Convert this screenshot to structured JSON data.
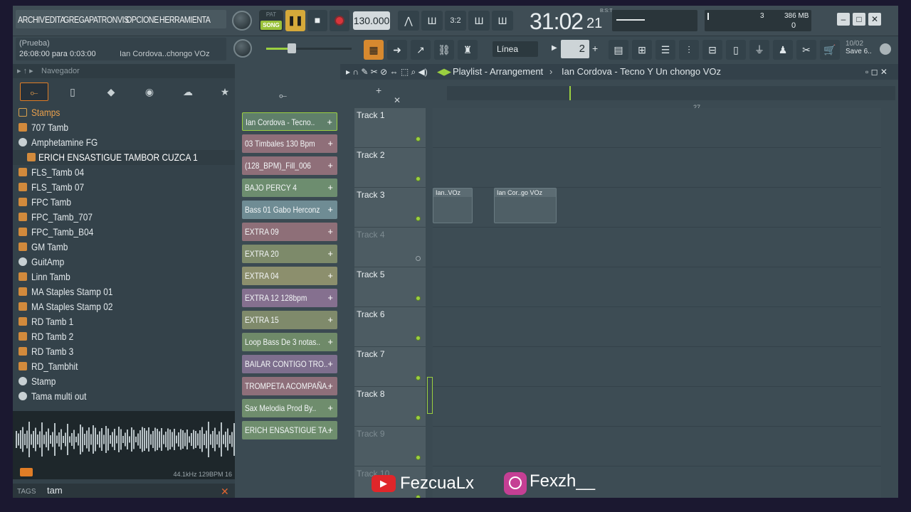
{
  "menu": {
    "items": [
      "ARCHIV",
      "EDITA",
      "GREGA",
      "PATRON",
      "VIS",
      "OPCIONE",
      "HERRAMIENTA"
    ]
  },
  "hint": {
    "line1": "(Prueba)",
    "line2": "26:08:00 para 0:03:00",
    "line3": "Ian Cordova..chongo VOz"
  },
  "transport": {
    "pat_label": "PAT",
    "song_label": "SONG",
    "play_icon": "pause-icon",
    "tempo": "130.000",
    "time_main": "31:02",
    "time_sub": "21",
    "time_bst": "B:S:T"
  },
  "monitor": {
    "cpu_value": "3",
    "mem_value": "386 MB",
    "poly_value": "0"
  },
  "toolbar2": {
    "snap": "Línea",
    "step": "2",
    "save_top": "10/02",
    "save_bottom": "Save 6.."
  },
  "browser": {
    "title": "Navegador",
    "items": [
      {
        "label": "Stamps",
        "type": "folder"
      },
      {
        "label": "707 Tamb",
        "type": "file"
      },
      {
        "label": "Amphetamine FG",
        "type": "plugin"
      },
      {
        "label": "ERICH ENSASTIGUE TAMBOR CUZCA 1",
        "type": "file"
      },
      {
        "label": "FLS_Tamb 04",
        "type": "file"
      },
      {
        "label": "FLS_Tamb 07",
        "type": "file"
      },
      {
        "label": "FPC Tamb",
        "type": "file"
      },
      {
        "label": "FPC_Tamb_707",
        "type": "file"
      },
      {
        "label": "FPC_Tamb_B04",
        "type": "file"
      },
      {
        "label": "GM Tamb",
        "type": "file"
      },
      {
        "label": "GuitAmp",
        "type": "plugin"
      },
      {
        "label": "Linn Tamb",
        "type": "file"
      },
      {
        "label": "MA Staples Stamp 01",
        "type": "file"
      },
      {
        "label": "MA Staples Stamp 02",
        "type": "file"
      },
      {
        "label": "RD Tamb 1",
        "type": "file"
      },
      {
        "label": "RD Tamb 2",
        "type": "file"
      },
      {
        "label": "RD Tamb 3",
        "type": "file"
      },
      {
        "label": "RD_Tambhit",
        "type": "file"
      },
      {
        "label": "Stamp",
        "type": "plugin"
      },
      {
        "label": "Tama multi out",
        "type": "plugin"
      }
    ],
    "wave_meta": "44.1kHz 129BPM 16",
    "tags_label": "TAGS",
    "tags_value": "tam"
  },
  "channels": [
    {
      "label": "Ian Cordova - Tecno..",
      "color": "#5f7f6a"
    },
    {
      "label": "03 Timbales 130 Bpm",
      "color": "#8f6f79"
    },
    {
      "label": "(128_BPM)_Fill_006",
      "color": "#8f6f79"
    },
    {
      "label": "BAJO PERCY 4",
      "color": "#6d8d6f"
    },
    {
      "label": "Bass 01 Gabo Herconz",
      "color": "#6f8c94"
    },
    {
      "label": "EXTRA 09",
      "color": "#8e6f78"
    },
    {
      "label": "EXTRA 20",
      "color": "#7d8a6a"
    },
    {
      "label": "EXTRA 04",
      "color": "#8c8f6d"
    },
    {
      "label": "EXTRA 12 128bpm",
      "color": "#85708f"
    },
    {
      "label": "EXTRA 15",
      "color": "#7f8a6b"
    },
    {
      "label": "Loop Bass De 3 notas..",
      "color": "#6f8a69"
    },
    {
      "label": "BAILAR CONTIGO TRO..",
      "color": "#7e6f8e"
    },
    {
      "label": "TROMPETA ACOMPAÑA..",
      "color": "#8e6f7a"
    },
    {
      "label": "Sax Melodia Prod By..",
      "color": "#6f8d6d"
    },
    {
      "label": "ERICH ENSASTIGUE TA..",
      "color": "#6f8e6e"
    }
  ],
  "playlist": {
    "title": "Playlist - Arrangement",
    "song": "Ian Cordova - Tecno Y Un chongo VOz",
    "bar_marker": "27",
    "tracks": [
      "Track 1",
      "Track 2",
      "Track 3",
      "Track 4",
      "Track 5",
      "Track 6",
      "Track 7",
      "Track 8",
      "Track 9",
      "Track 10"
    ],
    "clips": [
      {
        "label": "Ian..VOz",
        "track": 3
      },
      {
        "label": "Ian Cor..go VOz",
        "track": 3
      }
    ]
  },
  "social": {
    "youtube": "FezcuaLx",
    "instagram": "Fexzh__"
  }
}
